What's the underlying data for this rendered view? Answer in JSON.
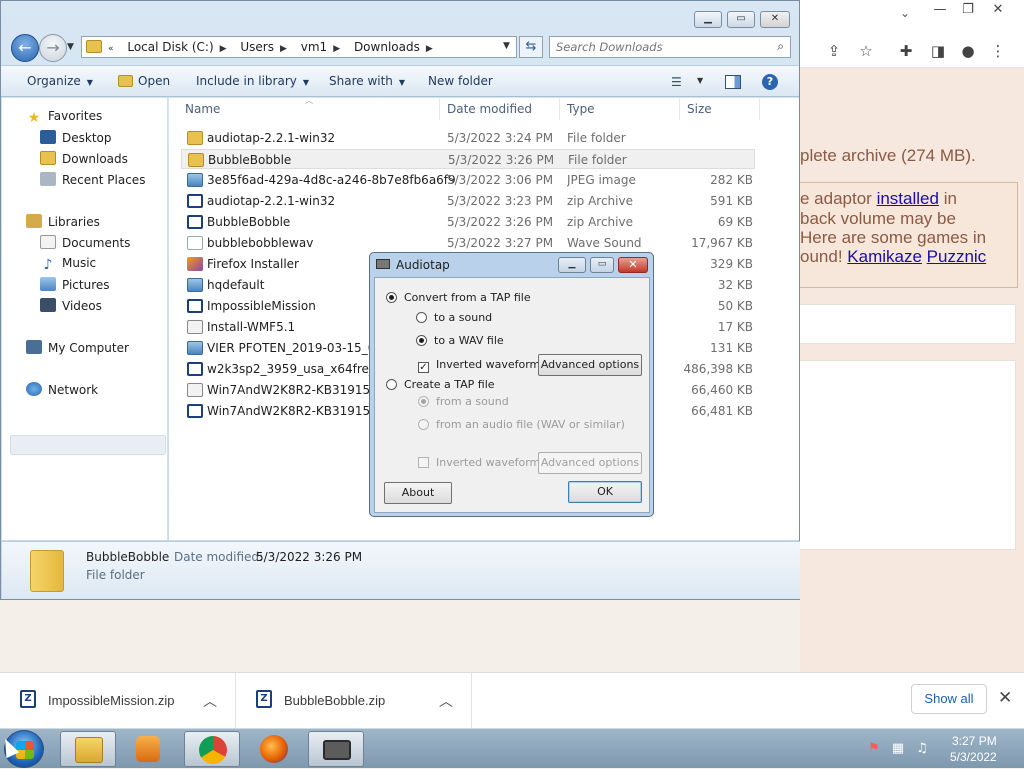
{
  "browser": {
    "web_texts": [
      "plete archive (274 MB).",
      "e adaptor",
      "installed",
      "in",
      "back volume may be",
      "Here are some games in",
      "ound!",
      "Kamikaze",
      "Puzznic"
    ],
    "downloads": [
      {
        "name": "ImpossibleMission.zip"
      },
      {
        "name": "BubbleBobble.zip"
      }
    ],
    "show_all": "Show all"
  },
  "explorer": {
    "breadcrumb": [
      "Local Disk (C:)",
      "Users",
      "vm1",
      "Downloads"
    ],
    "search_placeholder": "Search Downloads",
    "toolbar": {
      "organize": "Organize",
      "open": "Open",
      "include_in_library": "Include in library",
      "share_with": "Share with",
      "new_folder": "New folder"
    },
    "nav": {
      "favorites": "Favorites",
      "desktop": "Desktop",
      "downloads": "Downloads",
      "recent_places": "Recent Places",
      "libraries": "Libraries",
      "documents": "Documents",
      "music": "Music",
      "pictures": "Pictures",
      "videos": "Videos",
      "my_computer": "My Computer",
      "network": "Network"
    },
    "columns": {
      "name": "Name",
      "date": "Date modified",
      "type": "Type",
      "size": "Size"
    },
    "files": [
      {
        "name": "audiotap-2.2.1-win32",
        "date": "5/3/2022 3:24 PM",
        "type": "File folder",
        "size": "",
        "icon": "folder"
      },
      {
        "name": "BubbleBobble",
        "date": "5/3/2022 3:26 PM",
        "type": "File folder",
        "size": "",
        "icon": "folder"
      },
      {
        "name": "3e85f6ad-429a-4d8c-a246-8b7e8fb6a6f9",
        "date": "5/3/2022 3:06 PM",
        "type": "JPEG image",
        "size": "282 KB",
        "icon": "image"
      },
      {
        "name": "audiotap-2.2.1-win32",
        "date": "5/3/2022 3:23 PM",
        "type": "zip Archive",
        "size": "591 KB",
        "icon": "zip"
      },
      {
        "name": "BubbleBobble",
        "date": "5/3/2022 3:26 PM",
        "type": "zip Archive",
        "size": "69 KB",
        "icon": "zip"
      },
      {
        "name": "bubblebobblewav",
        "date": "5/3/2022 3:27 PM",
        "type": "Wave Sound",
        "size": "17,967 KB",
        "icon": "wav"
      },
      {
        "name": "Firefox Installer",
        "date": "",
        "type": "",
        "size": "329 KB",
        "icon": "exe"
      },
      {
        "name": "hqdefault",
        "date": "",
        "type": "",
        "size": "32 KB",
        "icon": "image"
      },
      {
        "name": "ImpossibleMission",
        "date": "",
        "type": "",
        "size": "50 KB",
        "icon": "zip"
      },
      {
        "name": "Install-WMF5.1",
        "date": "",
        "type": "S...",
        "size": "17 KB",
        "icon": "gen"
      },
      {
        "name": "VIER PFOTEN_2019-03-15_001-2",
        "date": "",
        "type": "",
        "size": "131 KB",
        "icon": "image"
      },
      {
        "name": "w2k3sp2_3959_usa_x64fre_spcd",
        "date": "",
        "type": "",
        "size": "486,398 KB",
        "icon": "zip"
      },
      {
        "name": "Win7AndW2K8R2-KB3191566-x",
        "date": "",
        "type": "e ...",
        "size": "66,460 KB",
        "icon": "gen"
      },
      {
        "name": "Win7AndW2K8R2-KB3191566-x",
        "date": "",
        "type": "",
        "size": "66,481 KB",
        "icon": "zip"
      }
    ],
    "details": {
      "name": "BubbleBobble",
      "modified_label": "Date modified:",
      "modified_value": "5/3/2022 3:26 PM",
      "type": "File folder"
    }
  },
  "dialog": {
    "title": "Audiotap",
    "convert_from_tap": "Convert from a TAP file",
    "to_a_sound": "to a sound",
    "to_a_wav": "to a WAV file",
    "inverted_waveform": "Inverted waveform",
    "advanced_options": "Advanced options",
    "create_tap": "Create a TAP file",
    "from_a_sound": "from a sound",
    "from_audio_file": "from an audio file (WAV or similar)",
    "inverted_waveform_2": "Inverted waveform",
    "advanced_options_2": "Advanced options",
    "about": "About",
    "ok": "OK"
  },
  "taskbar": {
    "time": "3:27 PM",
    "date": "5/3/2022"
  }
}
